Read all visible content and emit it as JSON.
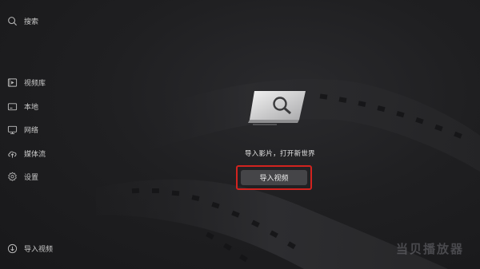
{
  "sidebar": {
    "search": {
      "label": "搜索",
      "icon": "search-icon"
    },
    "items": [
      {
        "label": "视频库",
        "icon": "video-library-icon"
      },
      {
        "label": "本地",
        "icon": "folder-icon"
      },
      {
        "label": "网络",
        "icon": "network-icon"
      },
      {
        "label": "媒体流",
        "icon": "cloud-icon"
      },
      {
        "label": "设置",
        "icon": "gear-icon"
      }
    ],
    "bottom": {
      "label": "导入视频",
      "icon": "import-icon"
    }
  },
  "main": {
    "empty_message": "导入影片，打开新世界",
    "import_button": "导入视频",
    "highlight_color": "#d2231f"
  },
  "watermark": "当贝播放器"
}
